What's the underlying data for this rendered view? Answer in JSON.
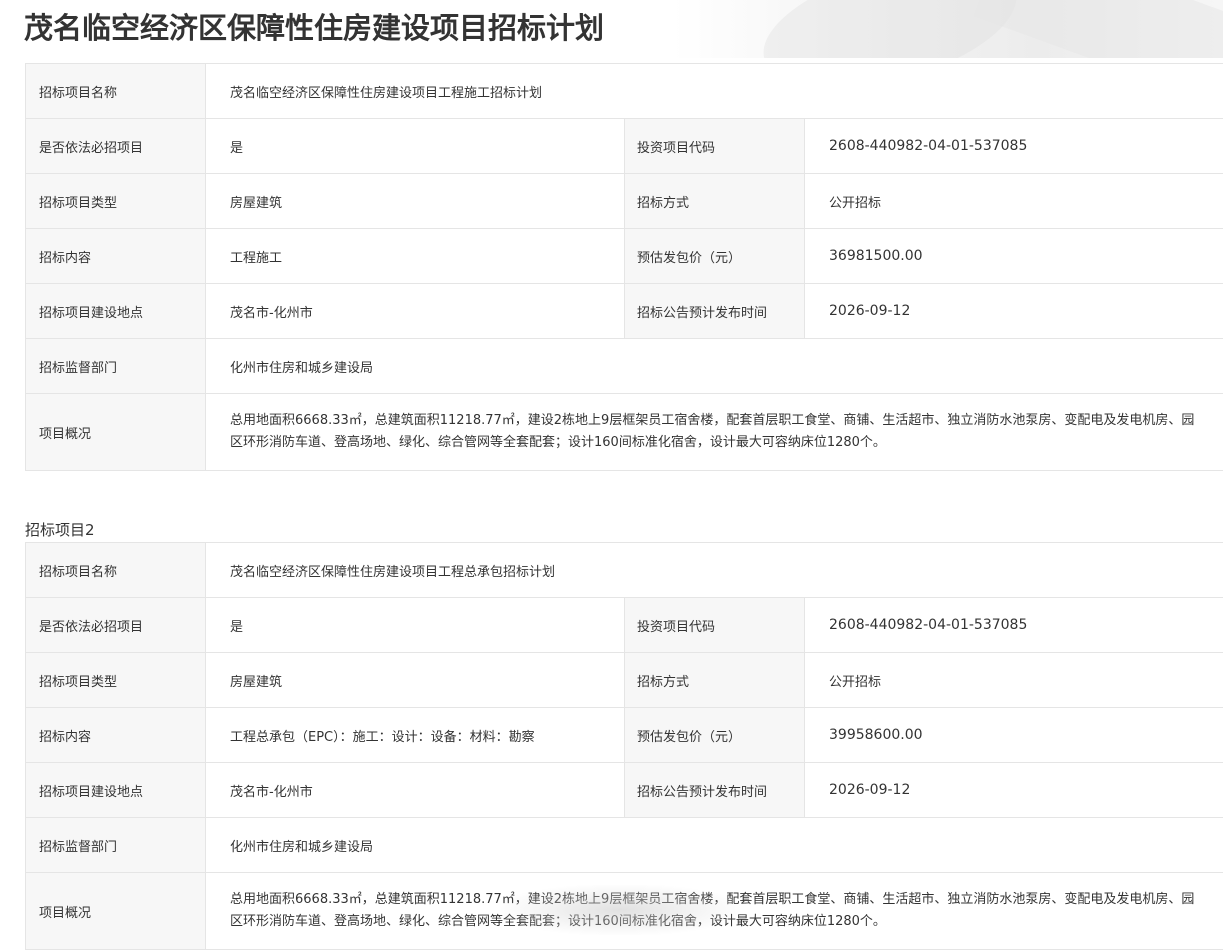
{
  "page": {
    "title": "茂名临空经济区保障性住房建设项目招标计划"
  },
  "projects": [
    {
      "section_label": "",
      "name_label": "招标项目名称",
      "name_value": "茂名临空经济区保障性住房建设项目工程施工招标计划",
      "required_label": "是否依法必招项目",
      "required_value": "是",
      "code_label": "投资项目代码",
      "code_value": "2608-440982-04-01-537085",
      "type_label": "招标项目类型",
      "type_value": "房屋建筑",
      "method_label": "招标方式",
      "method_value": "公开招标",
      "content_label": "招标内容",
      "content_value": "工程施工",
      "price_label": "预估发包价（元）",
      "price_value": "36981500.00",
      "location_label": "招标项目建设地点",
      "location_value": "茂名市-化州市",
      "publish_label": "招标公告预计发布时间",
      "publish_value": "2026-09-12",
      "dept_label": "招标监督部门",
      "dept_value": "化州市住房和城乡建设局",
      "overview_label": "项目概况",
      "overview_value": "总用地面积6668.33㎡，总建筑面积11218.77㎡，建设2栋地上9层框架员工宿舍楼，配套首层职工食堂、商铺、生活超市、独立消防水池泵房、变配电及发电机房、园区环形消防车道、登高场地、绿化、综合管网等全套配套；设计160间标准化宿舍，设计最大可容纳床位1280个。"
    },
    {
      "section_label": "招标项目2",
      "name_label": "招标项目名称",
      "name_value": "茂名临空经济区保障性住房建设项目工程总承包招标计划",
      "required_label": "是否依法必招项目",
      "required_value": "是",
      "code_label": "投资项目代码",
      "code_value": "2608-440982-04-01-537085",
      "type_label": "招标项目类型",
      "type_value": "房屋建筑",
      "method_label": "招标方式",
      "method_value": "公开招标",
      "content_label": "招标内容",
      "content_value": "工程总承包（EPC）：施工：设计：设备：材料：勘察",
      "price_label": "预估发包价（元）",
      "price_value": "39958600.00",
      "location_label": "招标项目建设地点",
      "location_value": "茂名市-化州市",
      "publish_label": "招标公告预计发布时间",
      "publish_value": "2026-09-12",
      "dept_label": "招标监督部门",
      "dept_value": "化州市住房和城乡建设局",
      "overview_label": "项目概况",
      "overview_value": "总用地面积6668.33㎡，总建筑面积11218.77㎡，建设2栋地上9层框架员工宿舍楼，配套首层职工食堂、商铺、生活超市、独立消防水池泵房、变配电及发电机房、园区环形消防车道、登高场地、绿化、综合管网等全套配套；设计160间标准化宿舍，设计最大可容纳床位1280个。"
    }
  ]
}
